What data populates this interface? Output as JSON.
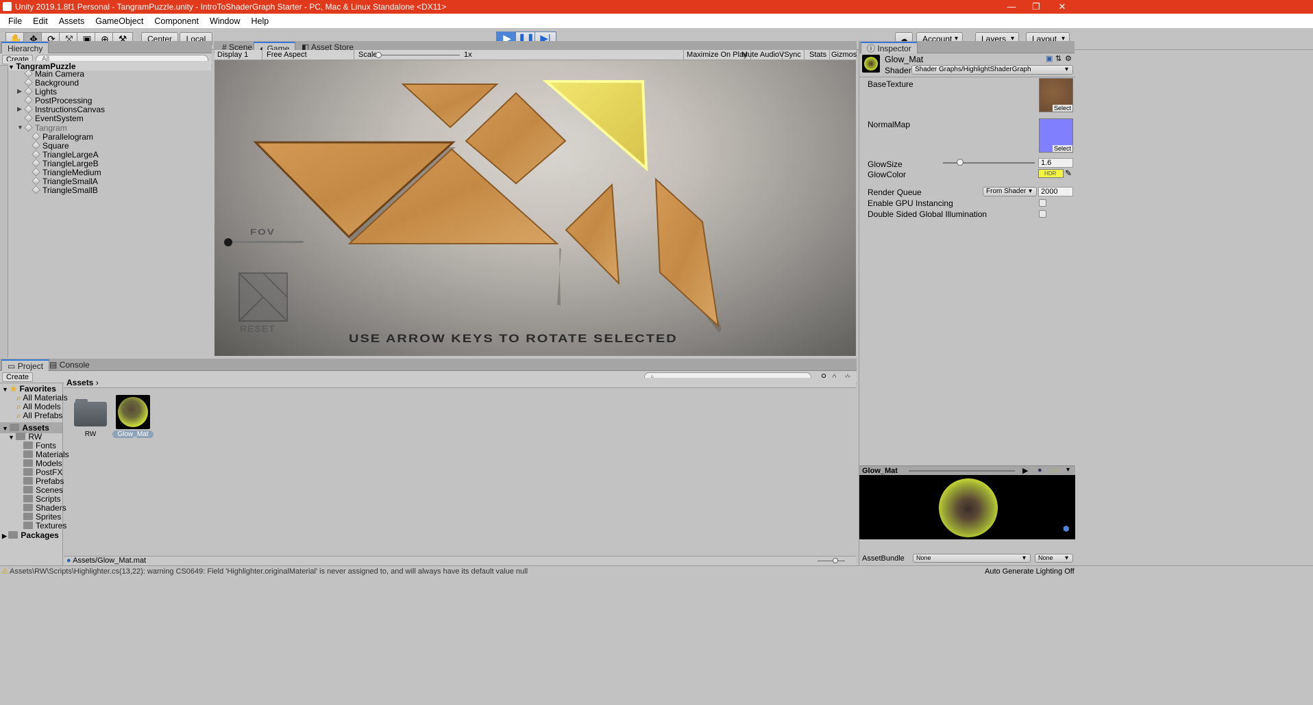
{
  "window": {
    "title": "Unity 2019.1.8f1 Personal - TangramPuzzle.unity - IntroToShaderGraph Starter - PC, Mac & Linux Standalone <DX11>",
    "min_glyph": "—",
    "max_glyph": "❐",
    "close_glyph": "✕"
  },
  "menu": [
    "File",
    "Edit",
    "Assets",
    "GameObject",
    "Component",
    "Window",
    "Help"
  ],
  "toolbar": {
    "tools": [
      "✋",
      "✥",
      "⟳",
      "⤧",
      "▣",
      "⊕",
      "⚒"
    ],
    "center": "Center",
    "local": "Local",
    "play": "▶",
    "pause": "❚❚",
    "step": "▶|",
    "cloud": "☁",
    "account": "Account",
    "layers": "Layers",
    "layout": "Layout"
  },
  "hierarchy": {
    "tab": "Hierarchy",
    "create": "Create",
    "search": "All",
    "scene": "TangramPuzzle",
    "items": [
      {
        "label": "Main Camera"
      },
      {
        "label": "Background"
      },
      {
        "label": "Lights"
      },
      {
        "label": "PostProcessing"
      },
      {
        "label": "InstructionsCanvas"
      },
      {
        "label": "EventSystem"
      },
      {
        "label": "Tangram"
      },
      {
        "label": "Parallelogram"
      },
      {
        "label": "Square"
      },
      {
        "label": "TriangleLargeA"
      },
      {
        "label": "TriangleLargeB"
      },
      {
        "label": "TriangleMedium"
      },
      {
        "label": "TriangleSmallA"
      },
      {
        "label": "TriangleSmallB"
      }
    ]
  },
  "center_tabs": {
    "scene": "Scene",
    "game": "Game",
    "store": "Asset Store"
  },
  "gamebar": {
    "display": "Display 1",
    "aspect": "Free Aspect",
    "scale_label": "Scale",
    "scale_value": "1x",
    "maximize": "Maximize On Play",
    "mute": "Mute Audio",
    "vsync": "VSync",
    "stats": "Stats",
    "gizmos": "Gizmos"
  },
  "game": {
    "fov": "FOV",
    "reset": "RESET",
    "instruction": "USE ARROW KEYS TO ROTATE SELECTED",
    "fov_level": 0.0
  },
  "project": {
    "tab_project": "Project",
    "tab_console": "Console",
    "create": "Create",
    "favorites": "Favorites",
    "fav_items": [
      "All Materials",
      "All Models",
      "All Prefabs"
    ],
    "assets": "Assets",
    "rw": "RW",
    "folders": [
      "Fonts",
      "Materials",
      "Models",
      "PostFX",
      "Prefabs",
      "Scenes",
      "Scripts",
      "Shaders",
      "Sprites",
      "Textures"
    ],
    "packages": "Packages",
    "breadcrumb": "Assets",
    "grid_items": [
      "RW",
      "Glow_Mat"
    ],
    "path": "Assets/Glow_Mat.mat"
  },
  "inspector": {
    "tab": "Inspector",
    "name": "Glow_Mat",
    "shader_label": "Shader",
    "shader_value": "Shader Graphs/HighlightShaderGraph",
    "base_texture": "BaseTexture",
    "normal_map": "NormalMap",
    "select": "Select",
    "glow_size": "GlowSize",
    "glow_size_value": "1.6",
    "glow_color": "GlowColor",
    "hdr": "HDR",
    "render_queue": "Render Queue",
    "render_queue_mode": "From Shader",
    "render_queue_value": "2000",
    "gpu_instancing": "Enable GPU Instancing",
    "double_sided": "Double Sided Global Illumination",
    "preview_title": "Glow_Mat",
    "asset_bundle": "AssetBundle",
    "bundle_none": "None",
    "variant_none": "None",
    "glow_color_hex": "#f2f542",
    "normal_color_hex": "#8080ff",
    "glow_size_level": 0.19
  },
  "status": {
    "warning": "Assets\\RW\\Scripts\\Highlighter.cs(13,22): warning CS0649: Field 'Highlighter.originalMaterial' is never assigned to, and will always have its default value null",
    "lighting": "Auto Generate Lighting Off"
  }
}
